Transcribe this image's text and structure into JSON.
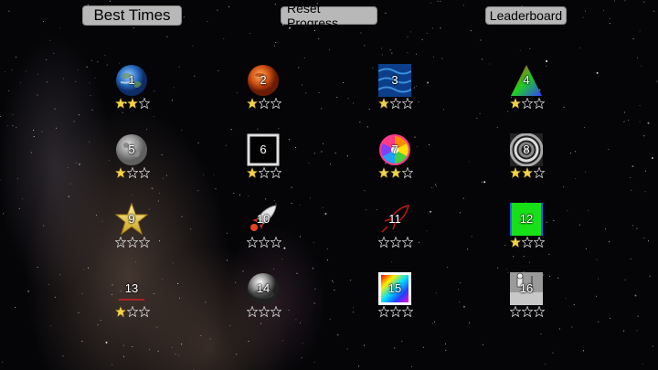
{
  "header": {
    "best_times_label": "Best Times",
    "reset_progress_label": "Reset Progress",
    "leaderboard_label": "Leaderboard"
  },
  "levels": [
    {
      "number": "1",
      "icon": "earth-icon",
      "stars": 2
    },
    {
      "number": "2",
      "icon": "mars-planet-icon",
      "stars": 1
    },
    {
      "number": "3",
      "icon": "water-tile-icon",
      "stars": 1
    },
    {
      "number": "4",
      "icon": "rainbow-triangle-icon",
      "stars": 1
    },
    {
      "number": "5",
      "icon": "moon-icon",
      "stars": 1
    },
    {
      "number": "6",
      "icon": "square-frame-icon",
      "stars": 1
    },
    {
      "number": "7",
      "icon": "swirl-lollipop-icon",
      "stars": 2
    },
    {
      "number": "8",
      "icon": "concentric-rings-icon",
      "stars": 2
    },
    {
      "number": "9",
      "icon": "gold-star-icon",
      "stars": 0
    },
    {
      "number": "10",
      "icon": "rocket-icon",
      "stars": 0
    },
    {
      "number": "11",
      "icon": "red-rocket-icon",
      "stars": 0
    },
    {
      "number": "12",
      "icon": "green-square-icon",
      "stars": 1
    },
    {
      "number": "13",
      "icon": "red-line-icon",
      "stars": 1
    },
    {
      "number": "14",
      "icon": "chrome-sphere-icon",
      "stars": 0
    },
    {
      "number": "15",
      "icon": "rainbow-square-icon",
      "stars": 0
    },
    {
      "number": "16",
      "icon": "moon-landing-icon",
      "stars": 0
    }
  ],
  "max_stars": 3,
  "colors": {
    "button_bg": "#b8b8b8",
    "star_filled": "#f2d24a",
    "star_empty_stroke": "#d0d0d0"
  }
}
